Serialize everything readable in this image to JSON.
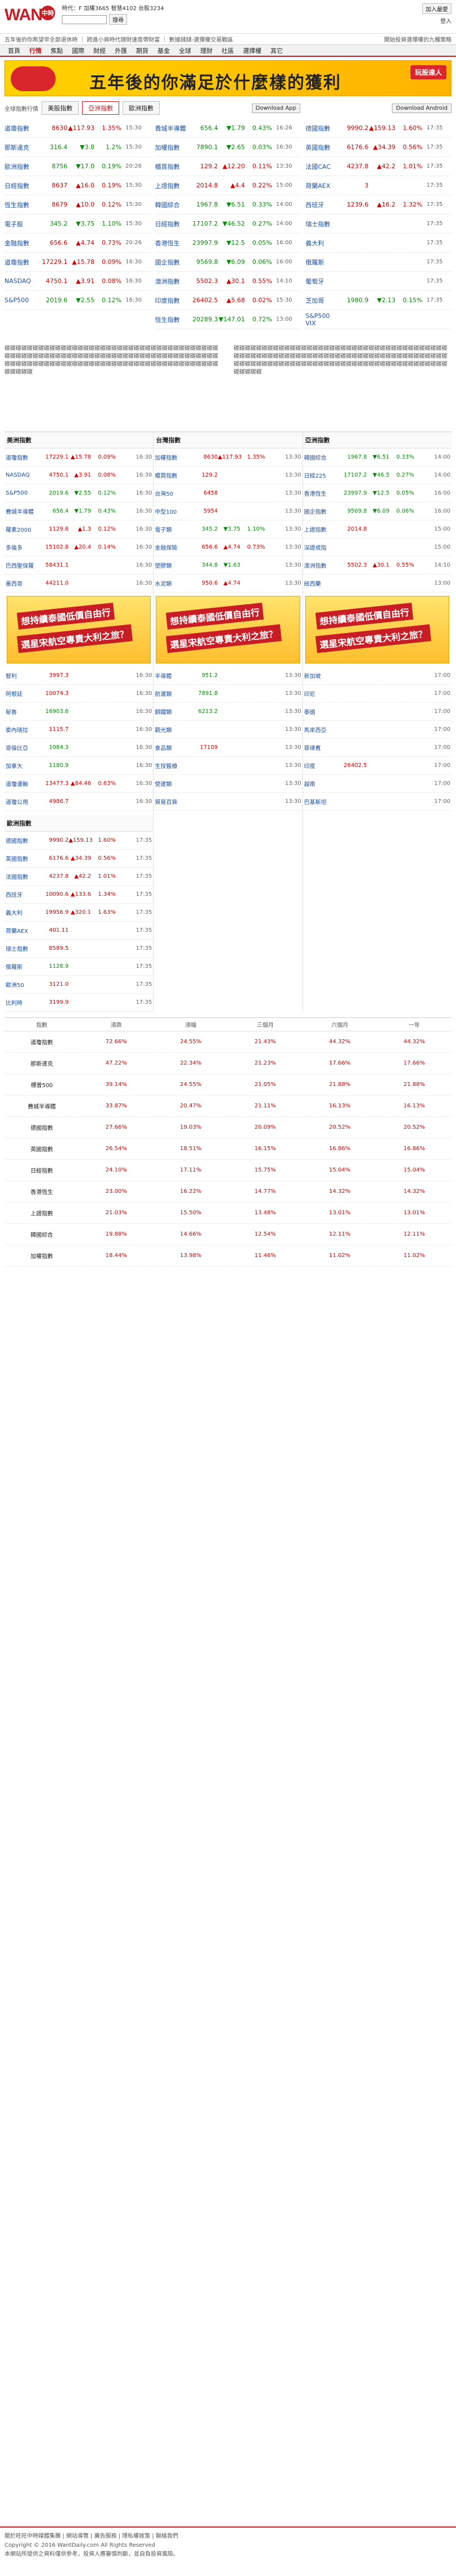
{
  "site": {
    "logo_text": "WANT",
    "logo_badge": "中時"
  },
  "header": {
    "ticker": "時代：F 加權3665 智慧4102 台股3234",
    "search_placeholder": "",
    "search_button": "搜尋",
    "fav": "加入最愛",
    "login": "登入",
    "tagline_left": "五年後的你希望早全部退休時 ｜ 跨進小資時代理財速度帶財富 ｜ 數據錢錢-選擇權交易戰區",
    "tagline_right": "開始投資選擇權的九種策略"
  },
  "nav": {
    "items": [
      "首頁",
      "行情",
      "焦點",
      "國際",
      "財經",
      "外匯",
      "期貨",
      "基金",
      "全球",
      "理財",
      "社區",
      "選擇權",
      "其它"
    ],
    "active": 1
  },
  "banner": {
    "text": "五年後的你滿足於什麼樣的獲利",
    "button": "玩股達人"
  },
  "top_tabs": {
    "label": "全球指數行情",
    "tabs": [
      "美股指數",
      "亞洲指數",
      "歐洲指數"
    ],
    "active": 1,
    "app_ios": "Download App",
    "app_android": "Download Android"
  },
  "top_cols": [
    [
      {
        "n": "道瓊指數",
        "v": "8630",
        "d": "117.93",
        "p": "1.35%",
        "t": "15:30",
        "dir": "up"
      },
      {
        "n": "那斯達克",
        "v": "316.4",
        "d": "3.8",
        "p": "1.2%",
        "t": "15:30",
        "dir": "dn"
      },
      {
        "n": "歐洲指數",
        "v": "8756",
        "d": "17.0",
        "p": "0.19%",
        "t": "20:26",
        "dir": "dn"
      },
      {
        "n": "日經指數",
        "v": "8637",
        "d": "16.0",
        "p": "0.19%",
        "t": "15:30",
        "dir": "up"
      },
      {
        "n": "恆生指數",
        "v": "8679",
        "d": "10.0",
        "p": "0.12%",
        "t": "15:30",
        "dir": "up"
      },
      {
        "n": "電子股",
        "v": "345.2",
        "d": "3.75",
        "p": "1.10%",
        "t": "15:30",
        "dir": "dn"
      },
      {
        "n": "金融指數",
        "v": "656.6",
        "d": "4.74",
        "p": "0.73%",
        "t": "20:26",
        "dir": "up"
      },
      {
        "n": "道瓊指數",
        "v": "17229.1",
        "d": "15.78",
        "p": "0.09%",
        "t": "16:30",
        "dir": "up"
      },
      {
        "n": "NASDAQ",
        "v": "4750.1",
        "d": "3.91",
        "p": "0.08%",
        "t": "16:30",
        "dir": "up"
      },
      {
        "n": "S&P500",
        "v": "2019.6",
        "d": "2.55",
        "p": "0.12%",
        "t": "16:30",
        "dir": "dn"
      }
    ],
    [
      {
        "n": "費城半導體",
        "v": "656.4",
        "d": "1.79",
        "p": "0.43%",
        "t": "16:26",
        "dir": "dn"
      },
      {
        "n": "加權指數",
        "v": "7890.1",
        "d": "2.65",
        "p": "0.03%",
        "t": "16:30",
        "dir": "dn"
      },
      {
        "n": "櫃買指數",
        "v": "129.2",
        "d": "12.20",
        "p": "0.11%",
        "t": "13:30",
        "dir": "up"
      },
      {
        "n": "上證指數",
        "v": "2014.8",
        "d": "4.4",
        "p": "0.22%",
        "t": "15:00",
        "dir": "up"
      },
      {
        "n": "韓國綜合",
        "v": "1967.8",
        "d": "6.51",
        "p": "0.33%",
        "t": "14:00",
        "dir": "dn"
      },
      {
        "n": "日經指數",
        "v": "17107.2",
        "d": "46.52",
        "p": "0.27%",
        "t": "14:00",
        "dir": "dn"
      },
      {
        "n": "香港恆生",
        "v": "23997.9",
        "d": "12.5",
        "p": "0.05%",
        "t": "16:00",
        "dir": "dn"
      },
      {
        "n": "國企指數",
        "v": "9569.8",
        "d": "6.09",
        "p": "0.06%",
        "t": "16:00",
        "dir": "dn"
      },
      {
        "n": "澳洲指數",
        "v": "5502.3",
        "d": "30.1",
        "p": "0.55%",
        "t": "14:10",
        "dir": "up"
      },
      {
        "n": "印度指數",
        "v": "26402.5",
        "d": "5.68",
        "p": "0.02%",
        "t": "15:30",
        "dir": "up"
      },
      {
        "n": "恆生指數",
        "v": "20289.3",
        "d": "147.01",
        "p": "0.72%",
        "t": "13:00",
        "dir": "dn"
      }
    ],
    [
      {
        "n": "德國指數",
        "v": "9990.2",
        "d": "159.13",
        "p": "1.60%",
        "t": "17:35",
        "dir": "up"
      },
      {
        "n": "英國指數",
        "v": "6176.6",
        "d": "34.39",
        "p": "0.56%",
        "t": "17:35",
        "dir": "up"
      },
      {
        "n": "法國CAC",
        "v": "4237.8",
        "d": "42.2",
        "p": "1.01%",
        "t": "17:35",
        "dir": "up"
      },
      {
        "n": "荷蘭AEX",
        "v": "3",
        "d": "",
        "p": "",
        "t": "17:35",
        "dir": "up"
      },
      {
        "n": "西班牙",
        "v": "1239.6",
        "d": "16.2",
        "p": "1.32%",
        "t": "17:35",
        "dir": "up"
      },
      {
        "n": "瑞士指數",
        "v": "",
        "d": "",
        "p": "",
        "t": "17:35",
        "dir": "up"
      },
      {
        "n": "義大利",
        "v": "",
        "d": "",
        "p": "",
        "t": "17:35",
        "dir": "up"
      },
      {
        "n": "俄羅斯",
        "v": "",
        "d": "",
        "p": "",
        "t": "17:35",
        "dir": "dn"
      },
      {
        "n": "葡萄牙",
        "v": "",
        "d": "",
        "p": "",
        "t": "17:35",
        "dir": "up"
      },
      {
        "n": "芝加哥",
        "v": "1980.9",
        "d": "2.13",
        "p": "0.15%",
        "t": "17:35",
        "dir": "dn"
      },
      {
        "n": "S&P500 VIX",
        "v": "",
        "d": "",
        "p": "",
        "t": "",
        "dir": "up"
      }
    ]
  ],
  "text_blocks": [
    "碳碳碳碳碳碳碳碳碳碳碳碳碳碳碳碳碳碳碳碳碳碳碳碳碳碳碳碳碳碳碳碳碳碳碳碳碳碳碳碳碳碳碳碳碳碳碳碳碳碳碳碳碳碳碳碳碳碳碳碳碳碳碳碳碳碳碳碳碳碳碳碳碳碳碳碳碳碳碳碳碳碳碳碳碳碳碳碳碳碳碳碳碳碳碳碳碳碳碳碳碳碳碳碳碳碳碳碳碳碳碳碳碳碳碳碳碳碳碳",
    "碳碳碳碳碳碳碳碳碳碳碳碳碳碳碳碳碳碳碳碳碳碳碳碳碳碳碳碳碳碳碳碳碳碳碳碳碳碳碳碳碳碳碳碳碳碳碳碳碳碳碳碳碳碳碳碳碳碳碳碳碳碳碳碳碳碳碳碳碳碳碳碳碳碳碳碳碳碳碳碳碳碳碳碳碳碳碳碳碳碳碳碳碳碳碳碳碳碳碳碳碳碳碳碳碳碳碳碳碳碳碳碳碳碳碳碳碳碳碳"
  ],
  "market": {
    "col1_title": "美洲指數",
    "col2_title": "台灣指數",
    "col3_title": "亞洲指數",
    "col1": [
      {
        "n": "道瓊指數",
        "v": "17229.1",
        "d": "15.78",
        "p": "0.09%",
        "t": "16:30",
        "dir": "up"
      },
      {
        "n": "NASDAQ",
        "v": "4750.1",
        "d": "3.91",
        "p": "0.08%",
        "t": "16:30",
        "dir": "up"
      },
      {
        "n": "S&P500",
        "v": "2019.6",
        "d": "2.55",
        "p": "0.12%",
        "t": "16:30",
        "dir": "dn"
      },
      {
        "n": "費城半導體",
        "v": "656.4",
        "d": "1.79",
        "p": "0.43%",
        "t": "16:30",
        "dir": "dn"
      },
      {
        "n": "羅素2000",
        "v": "1129.6",
        "d": "1.3",
        "p": "0.12%",
        "t": "16:30",
        "dir": "up"
      },
      {
        "n": "多倫多",
        "v": "15102.8",
        "d": "20.4",
        "p": "0.14%",
        "t": "16:30",
        "dir": "up"
      },
      {
        "n": "巴西聖保羅",
        "v": "58431.1",
        "d": "",
        "p": "",
        "t": "16:30",
        "dir": "up"
      },
      {
        "n": "墨西哥",
        "v": "44211.0",
        "d": "",
        "p": "",
        "t": "16:30",
        "dir": "up"
      },
      {
        "n": "智利",
        "v": "3997.3",
        "d": "",
        "p": "",
        "t": "16:30",
        "dir": "up"
      },
      {
        "n": "阿根廷",
        "v": "10074.3",
        "d": "",
        "p": "",
        "t": "16:30",
        "dir": "up"
      },
      {
        "n": "秘魯",
        "v": "16903.6",
        "d": "",
        "p": "",
        "t": "16:30",
        "dir": "dn"
      },
      {
        "n": "委內瑞拉",
        "v": "1115.7",
        "d": "",
        "p": "",
        "t": "16:30",
        "dir": "up"
      },
      {
        "n": "哥倫比亞",
        "v": "1084.3",
        "d": "",
        "p": "",
        "t": "16:30",
        "dir": "dn"
      },
      {
        "n": "加拿大",
        "v": "1180.9",
        "d": "",
        "p": "",
        "t": "16:30",
        "dir": "dn"
      },
      {
        "n": "道瓊運輸",
        "v": "13477.3",
        "d": "84.46",
        "p": "0.63%",
        "t": "16:30",
        "dir": "up"
      },
      {
        "n": "道瓊公用",
        "v": "4986.7",
        "d": "",
        "p": "",
        "t": "16:30",
        "dir": "up"
      }
    ],
    "col2": [
      {
        "n": "加權指數",
        "v": "8630",
        "d": "117.93",
        "p": "1.35%",
        "t": "13:30",
        "dir": "up"
      },
      {
        "n": "櫃買指數",
        "v": "129.2",
        "d": "",
        "p": "",
        "t": "13:30",
        "dir": "up"
      },
      {
        "n": "台灣50",
        "v": "6458",
        "d": "",
        "p": "",
        "t": "13:30",
        "dir": "up"
      },
      {
        "n": "中型100",
        "v": "5954",
        "d": "",
        "p": "",
        "t": "13:30",
        "dir": "up"
      },
      {
        "n": "電子類",
        "v": "345.2",
        "d": "3.75",
        "p": "1.10%",
        "t": "13:30",
        "dir": "dn"
      },
      {
        "n": "金融保險",
        "v": "656.6",
        "d": "4.74",
        "p": "0.73%",
        "t": "13:30",
        "dir": "up"
      },
      {
        "n": "塑膠類",
        "v": "344.8",
        "d": "1.63",
        "p": "",
        "t": "13:30",
        "dir": "dn"
      },
      {
        "n": "水泥類",
        "v": "950.6",
        "d": "4.74",
        "p": "",
        "t": "13:30",
        "dir": "up"
      },
      {
        "n": "半導體",
        "v": "951.2",
        "d": "",
        "p": "",
        "t": "13:30",
        "dir": "dn"
      },
      {
        "n": "航運類",
        "v": "7891.8",
        "d": "",
        "p": "",
        "t": "13:30",
        "dir": "dn"
      },
      {
        "n": "鋼鐵類",
        "v": "6213.2",
        "d": "",
        "p": "",
        "t": "13:30",
        "dir": "dn"
      },
      {
        "n": "觀光類",
        "v": "",
        "d": "",
        "p": "",
        "t": "13:30",
        "dir": "up"
      },
      {
        "n": "食品類",
        "v": "17109",
        "d": "",
        "p": "",
        "t": "13:30",
        "dir": "up"
      },
      {
        "n": "生技醫療",
        "v": "",
        "d": "",
        "p": "",
        "t": "13:30",
        "dir": "up"
      },
      {
        "n": "營建類",
        "v": "",
        "d": "",
        "p": "",
        "t": "13:30",
        "dir": "up"
      },
      {
        "n": "貿易百貨",
        "v": "",
        "d": "",
        "p": "",
        "t": "13:30",
        "dir": "dn"
      }
    ],
    "col3": [
      {
        "n": "韓國綜合",
        "v": "1967.8",
        "d": "6.51",
        "p": "0.33%",
        "t": "14:00",
        "dir": "dn"
      },
      {
        "n": "日經225",
        "v": "17107.2",
        "d": "46.5",
        "p": "0.27%",
        "t": "14:00",
        "dir": "dn"
      },
      {
        "n": "香港恆生",
        "v": "23997.9",
        "d": "12.5",
        "p": "0.05%",
        "t": "16:00",
        "dir": "dn"
      },
      {
        "n": "國企指數",
        "v": "9569.8",
        "d": "6.09",
        "p": "0.06%",
        "t": "16:00",
        "dir": "dn"
      },
      {
        "n": "上證指數",
        "v": "2014.8",
        "d": "",
        "p": "",
        "t": "15:00",
        "dir": "up"
      },
      {
        "n": "深證成指",
        "v": "",
        "d": "",
        "p": "",
        "t": "15:00",
        "dir": "up"
      },
      {
        "n": "澳洲指數",
        "v": "5502.3",
        "d": "30.1",
        "p": "0.55%",
        "t": "14:10",
        "dir": "up"
      },
      {
        "n": "紐西蘭",
        "v": "",
        "d": "",
        "p": "",
        "t": "13:00",
        "dir": "up"
      },
      {
        "n": "新加坡",
        "v": "",
        "d": "",
        "p": "",
        "t": "17:00",
        "dir": "up"
      },
      {
        "n": "印尼",
        "v": "",
        "d": "",
        "p": "",
        "t": "17:00",
        "dir": "up"
      },
      {
        "n": "泰國",
        "v": "",
        "d": "",
        "p": "",
        "t": "17:00",
        "dir": "up"
      },
      {
        "n": "馬來西亞",
        "v": "",
        "d": "",
        "p": "",
        "t": "17:00",
        "dir": "dn"
      },
      {
        "n": "菲律賓",
        "v": "",
        "d": "",
        "p": "",
        "t": "17:00",
        "dir": "dn"
      },
      {
        "n": "印度",
        "v": "26402.5",
        "d": "",
        "p": "",
        "t": "17:00",
        "dir": "up"
      },
      {
        "n": "越南",
        "v": "",
        "d": "",
        "p": "",
        "t": "17:00",
        "dir": "up"
      },
      {
        "n": "巴基斯坦",
        "v": "",
        "d": "",
        "p": "",
        "t": "17:00",
        "dir": "up"
      }
    ],
    "ad_line1": "想持續泰國低價自由行",
    "ad_line2": "選星宋航空專責大利之旅？"
  },
  "europe_title": "歐洲指數",
  "europe_rows": [
    {
      "n": "德國指數",
      "v": "9990.2",
      "d": "159.13",
      "p": "1.60%",
      "t": "17:35",
      "dir": "up"
    },
    {
      "n": "英國指數",
      "v": "6176.6",
      "d": "34.39",
      "p": "0.56%",
      "t": "17:35",
      "dir": "up"
    },
    {
      "n": "法國指數",
      "v": "4237.8",
      "d": "42.2",
      "p": "1.01%",
      "t": "17:35",
      "dir": "up"
    },
    {
      "n": "西班牙",
      "v": "10090.6",
      "d": "133.6",
      "p": "1.34%",
      "t": "17:35",
      "dir": "up"
    },
    {
      "n": "義大利",
      "v": "19956.9",
      "d": "320.1",
      "p": "1.63%",
      "t": "17:35",
      "dir": "up"
    },
    {
      "n": "荷蘭AEX",
      "v": "401.11",
      "d": "",
      "p": "",
      "t": "17:35",
      "dir": "up"
    },
    {
      "n": "瑞士指數",
      "v": "8589.5",
      "d": "",
      "p": "",
      "t": "17:35",
      "dir": "up"
    },
    {
      "n": "俄羅斯",
      "v": "1128.9",
      "d": "",
      "p": "",
      "t": "17:35",
      "dir": "dn"
    },
    {
      "n": "歐洲50",
      "v": "3121.0",
      "d": "",
      "p": "",
      "t": "17:35",
      "dir": "up"
    },
    {
      "n": "比利時",
      "v": "3199.9",
      "d": "",
      "p": "",
      "t": "17:35",
      "dir": "up"
    }
  ],
  "bottom_table": {
    "headers": [
      "指數",
      "漲跌",
      "漲幅",
      "三個月",
      "六個月",
      "一年"
    ],
    "rows": [
      [
        "道瓊指數",
        "72.66%",
        "24.55%",
        "21.43%",
        "44.32%",
        "44.32%"
      ],
      [
        "那斯達克",
        "47.22%",
        "22.34%",
        "21.23%",
        "17.66%",
        "17.66%"
      ],
      [
        "標普500",
        "39.14%",
        "24.55%",
        "21.05%",
        "21.88%",
        "21.88%"
      ],
      [
        "費城半導體",
        "33.87%",
        "20.47%",
        "21.11%",
        "16.13%",
        "16.13%"
      ],
      [
        "德國指數",
        "27.66%",
        "19.03%",
        "20.09%",
        "20.52%",
        "20.52%"
      ],
      [
        "英國指數",
        "26.54%",
        "18.51%",
        "16.15%",
        "16.86%",
        "16.86%"
      ],
      [
        "日經指數",
        "24.10%",
        "17.11%",
        "15.75%",
        "15.04%",
        "15.04%"
      ],
      [
        "香港恆生",
        "23.00%",
        "16.22%",
        "14.77%",
        "14.32%",
        "14.32%"
      ],
      [
        "上證指數",
        "21.03%",
        "15.50%",
        "13.48%",
        "13.01%",
        "13.01%"
      ],
      [
        "韓國綜合",
        "19.88%",
        "14.66%",
        "12.54%",
        "12.11%",
        "12.11%"
      ],
      [
        "加權指數",
        "18.44%",
        "13.98%",
        "11.46%",
        "11.02%",
        "11.02%"
      ]
    ]
  },
  "footer": {
    "line1": "關於旺旺中時媒體集團 | 網站導覽 | 廣告服務 | 隱私權政策 | 聯絡我們",
    "line2": "Copyright © 2016 WantDaily.com All Rights Reserved",
    "line3": "本網站所提供之資料僅供參考，投資人應審慎判斷，並自負投資風險。"
  }
}
